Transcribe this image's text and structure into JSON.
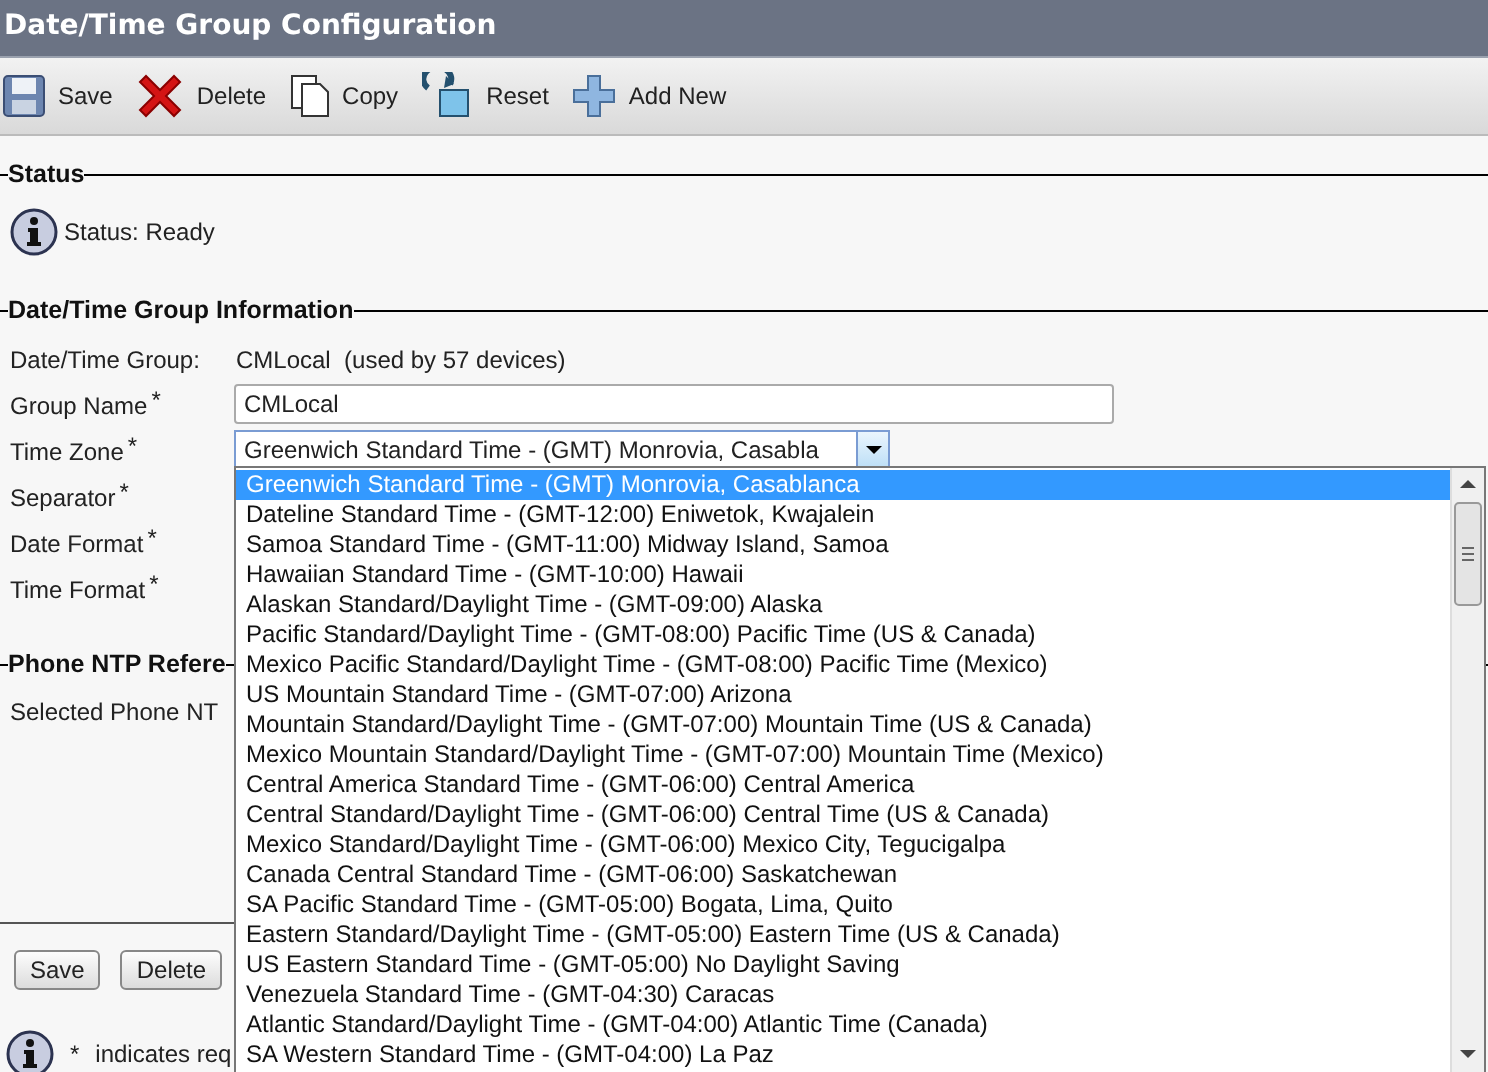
{
  "window": {
    "title": "Date/Time Group Configuration"
  },
  "toolbar": [
    {
      "kind": "save",
      "label": "Save"
    },
    {
      "kind": "delete",
      "label": "Delete"
    },
    {
      "kind": "copy",
      "label": "Copy"
    },
    {
      "kind": "reset",
      "label": "Reset"
    },
    {
      "kind": "add",
      "label": "Add New"
    }
  ],
  "status_section": {
    "legend": "Status",
    "text": "Status: Ready"
  },
  "info_section": {
    "legend": "Date/Time Group Information",
    "group_label": "Date/Time Group:",
    "group_value": "CMLocal  (used by 57 devices)",
    "fields": [
      {
        "label": "Group Name",
        "required": "*",
        "kind": "text",
        "value": "CMLocal"
      },
      {
        "label": "Time Zone",
        "required": "*",
        "kind": "select",
        "value": "Greenwich Standard Time - (GMT) Monrovia, Casabla"
      },
      {
        "label": "Separator",
        "required": "*",
        "kind": "covered"
      },
      {
        "label": "Date Format",
        "required": "*",
        "kind": "covered"
      },
      {
        "label": "Time Format",
        "required": "*",
        "kind": "covered"
      }
    ]
  },
  "ntp_section": {
    "legend": "Phone NTP Refere",
    "text": "Selected Phone NT"
  },
  "buttons": [
    "Save",
    "Delete"
  ],
  "footer": {
    "mark": "*",
    "text": "indicates req"
  },
  "dropdown": {
    "items": [
      {
        "label": "Greenwich Standard Time - (GMT) Monrovia, Casablanca",
        "selected": true
      },
      {
        "label": "Dateline Standard Time - (GMT-12:00) Eniwetok, Kwajalein",
        "selected": false
      },
      {
        "label": "Samoa Standard Time - (GMT-11:00) Midway Island, Samoa",
        "selected": false
      },
      {
        "label": "Hawaiian Standard Time - (GMT-10:00) Hawaii",
        "selected": false
      },
      {
        "label": "Alaskan Standard/Daylight Time - (GMT-09:00) Alaska",
        "selected": false
      },
      {
        "label": "Pacific Standard/Daylight Time - (GMT-08:00) Pacific Time (US & Canada)",
        "selected": false
      },
      {
        "label": "Mexico Pacific Standard/Daylight Time - (GMT-08:00) Pacific Time (Mexico)",
        "selected": false
      },
      {
        "label": "US Mountain Standard Time - (GMT-07:00) Arizona",
        "selected": false
      },
      {
        "label": "Mountain Standard/Daylight Time - (GMT-07:00) Mountain Time (US & Canada)",
        "selected": false
      },
      {
        "label": "Mexico Mountain Standard/Daylight Time - (GMT-07:00) Mountain Time (Mexico)",
        "selected": false
      },
      {
        "label": "Central America Standard Time - (GMT-06:00) Central America",
        "selected": false
      },
      {
        "label": "Central Standard/Daylight Time - (GMT-06:00) Central Time (US & Canada)",
        "selected": false
      },
      {
        "label": "Mexico Standard/Daylight Time - (GMT-06:00) Mexico City, Tegucigalpa",
        "selected": false
      },
      {
        "label": "Canada Central Standard Time - (GMT-06:00) Saskatchewan",
        "selected": false
      },
      {
        "label": "SA Pacific Standard Time - (GMT-05:00) Bogata, Lima, Quito",
        "selected": false
      },
      {
        "label": "Eastern Standard/Daylight Time - (GMT-05:00) Eastern Time (US & Canada)",
        "selected": false
      },
      {
        "label": "US Eastern Standard Time - (GMT-05:00) No Daylight Saving",
        "selected": false
      },
      {
        "label": "Venezuela Standard Time - (GMT-04:30) Caracas",
        "selected": false
      },
      {
        "label": "Atlantic Standard/Daylight Time - (GMT-04:00) Atlantic Time (Canada)",
        "selected": false
      },
      {
        "label": "SA Western Standard Time - (GMT-04:00) La Paz",
        "selected": false
      }
    ]
  }
}
